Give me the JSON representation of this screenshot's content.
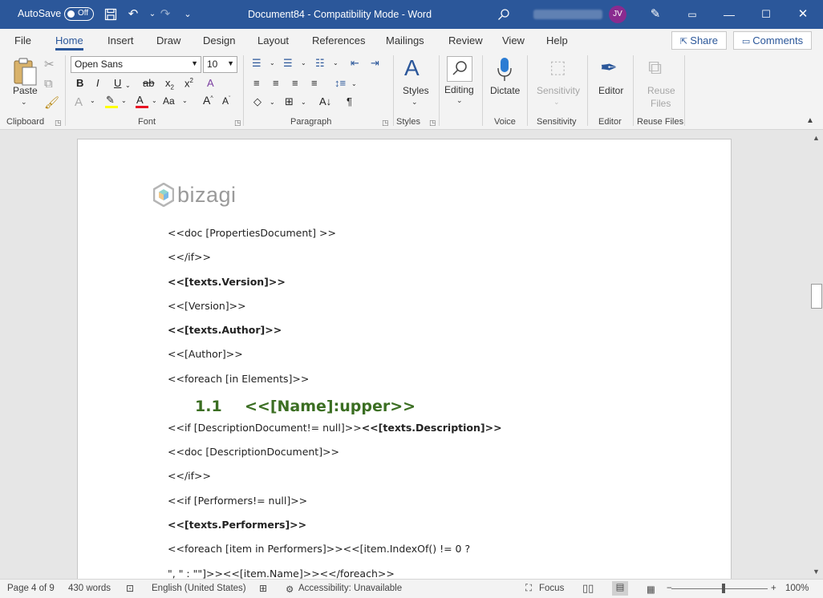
{
  "titlebar": {
    "autosave_label": "AutoSave",
    "autosave_state": "Off",
    "document_title": "Document84  -  Compatibility Mode  -  Word",
    "avatar_initials": "JV"
  },
  "menu": {
    "tabs": [
      "File",
      "Home",
      "Insert",
      "Draw",
      "Design",
      "Layout",
      "References",
      "Mailings",
      "Review",
      "View",
      "Help"
    ],
    "active_tab": "Home",
    "share_label": "Share",
    "comments_label": "Comments"
  },
  "ribbon": {
    "clipboard": {
      "label": "Clipboard",
      "paste_label": "Paste"
    },
    "font": {
      "label": "Font",
      "font_name": "Open Sans",
      "font_size": "10"
    },
    "paragraph": {
      "label": "Paragraph"
    },
    "styles": {
      "label": "Styles",
      "button": "Styles"
    },
    "editing": {
      "button": "Editing"
    },
    "voice": {
      "label": "Voice",
      "button": "Dictate"
    },
    "sensitivity": {
      "label": "Sensitivity",
      "button": "Sensitivity"
    },
    "editor": {
      "label": "Editor",
      "button": "Editor"
    },
    "reuse": {
      "label": "Reuse Files",
      "button_line1": "Reuse",
      "button_line2": "Files"
    }
  },
  "document": {
    "logo_text": "bizagi",
    "lines": [
      {
        "text": "<<doc [PropertiesDocument] >>"
      },
      {
        "text": "<</if>>"
      },
      {
        "text": "<<[texts.Version]>>",
        "bold": true
      },
      {
        "text": "<<[Version]>>"
      },
      {
        "text": "<<[texts.Author]>>",
        "bold": true
      },
      {
        "text": "<<[Author]>>"
      },
      {
        "text": "<<foreach [in Elements]>>"
      }
    ],
    "heading_number": "1.1",
    "heading_text": "<<[Name]:upper>>",
    "mixed_line_plain": "<<if [DescriptionDocument!= null]>>",
    "mixed_line_bold": "<<[texts.Description]>>",
    "lines2": [
      {
        "text": "<<doc [DescriptionDocument]>>"
      },
      {
        "text": "<</if>>"
      },
      {
        "text": "<<if [Performers!= null]>>"
      },
      {
        "text": "<<[texts.Performers]>>",
        "bold": true
      },
      {
        "text": "<<foreach [item in Performers]>><<[item.IndexOf() != 0 ?"
      },
      {
        "text": "\", \" : \"\"]>><<[item.Name]>><</foreach>>"
      }
    ]
  },
  "statusbar": {
    "page": "Page 4 of 9",
    "words": "430 words",
    "language": "English (United States)",
    "accessibility": "Accessibility: Unavailable",
    "focus": "Focus",
    "zoom": "100%"
  },
  "colors": {
    "title_bar": "#2b579a",
    "heading_green": "#3b6e22",
    "avatar_purple": "#8a2b8f"
  }
}
